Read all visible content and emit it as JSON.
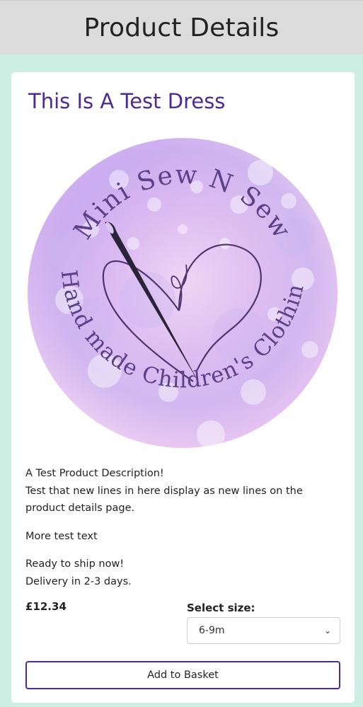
{
  "header": {
    "title": "Product Details"
  },
  "product": {
    "name": "This Is A Test Dress",
    "logo": {
      "top_text": "Mini Sew N Sew",
      "bottom_text": "Hand made Children's Clothing",
      "icon": "needle-heart-icon"
    },
    "description": {
      "line1": "A Test Product Description!",
      "line2": "Test that new lines in here display as new lines on the product details page.",
      "para2": "More test text",
      "line3": "Ready to ship now!",
      "line4": "Delivery in 2-3 days."
    },
    "price": "£12.34",
    "size_label": "Select size:",
    "size_selected": "6-9m",
    "add_button": "Add to Basket"
  },
  "colors": {
    "accent": "#4d2a96",
    "page_bg": "#cdeee3",
    "header_bg": "#dcdcdc"
  }
}
